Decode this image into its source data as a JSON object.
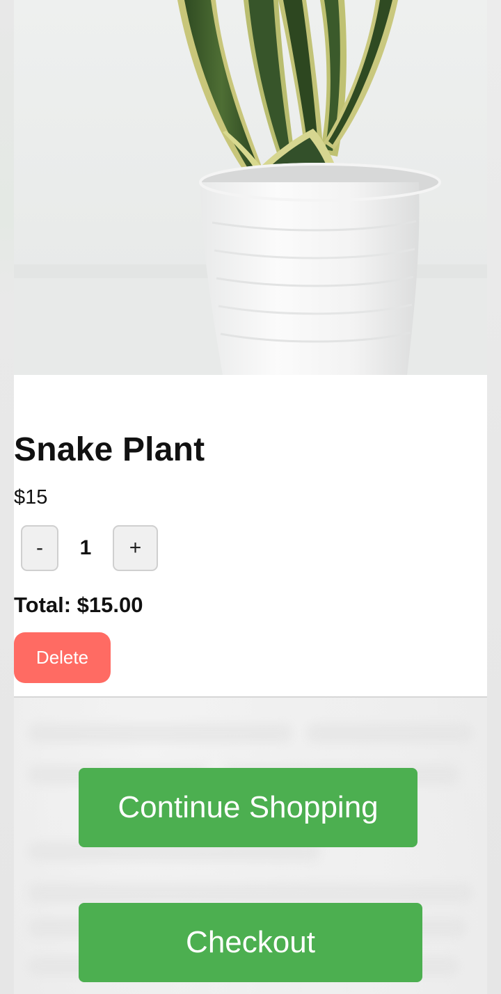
{
  "product": {
    "image_alt": "Snake Plant",
    "name": "Snake Plant",
    "price": "$15"
  },
  "quantity": {
    "decrement_label": "-",
    "value": "1",
    "increment_label": "+"
  },
  "total": {
    "text": "Total: $15.00"
  },
  "actions": {
    "delete_label": "Delete",
    "continue_label": "Continue Shopping",
    "checkout_label": "Checkout"
  },
  "colors": {
    "primary_green": "#4caf50",
    "delete_red": "#ff6b63"
  }
}
